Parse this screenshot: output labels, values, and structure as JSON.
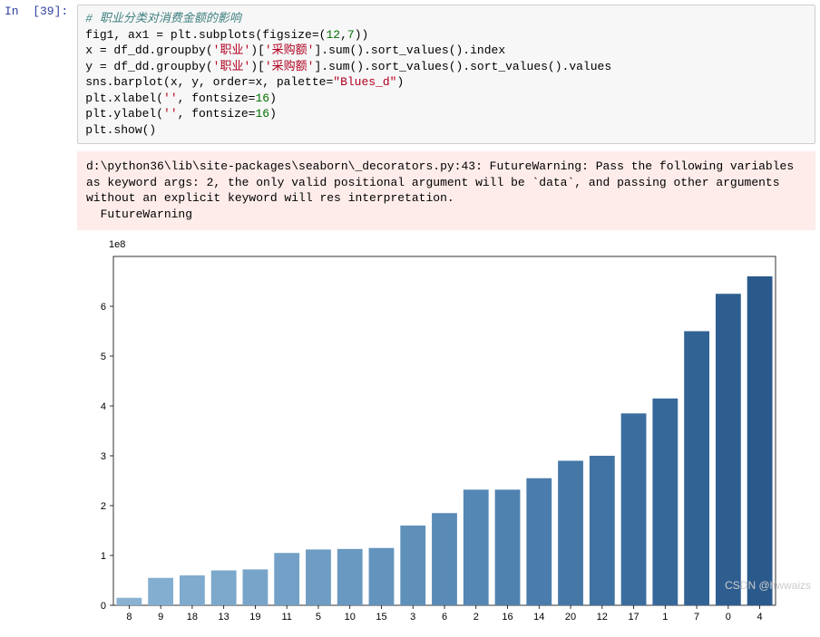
{
  "prompt": "In  [39]:",
  "code": {
    "comment": "# 职业分类对消费金额的影响",
    "line1_a": "fig1, ax1 = plt.subplots(figsize=(",
    "line1_b": "12",
    "line1_c": ",",
    "line1_d": "7",
    "line1_e": "))",
    "line2_a": "x = df_dd.groupby(",
    "line2_b": "'职业'",
    "line2_c": ")[",
    "line2_d": "'采购额'",
    "line2_e": "].sum().sort_values().index",
    "line3_a": "y = df_dd.groupby(",
    "line3_b": "'职业'",
    "line3_c": ")[",
    "line3_d": "'采购额'",
    "line3_e": "].sum().sort_values().sort_values().values",
    "line4_a": "sns.barplot(x, y, order=x, palette=",
    "line4_b": "\"Blues_d\"",
    "line4_c": ")",
    "line5_a": "plt.xlabel(",
    "line5_b": "''",
    "line5_c": ", fontsize=",
    "line5_d": "16",
    "line5_e": ")",
    "line6_a": "plt.ylabel(",
    "line6_b": "''",
    "line6_c": ", fontsize=",
    "line6_d": "16",
    "line6_e": ")",
    "line7": "plt.show()"
  },
  "warning": "d:\\python36\\lib\\site-packages\\seaborn\\_decorators.py:43: FutureWarning: Pass the following variables as keyword args: 2, the only valid positional argument will be `data`, and passing other arguments without an explicit keyword will res interpretation.\n  FutureWarning",
  "scale_label": "1e8",
  "chart_data": {
    "type": "bar",
    "categories": [
      "8",
      "9",
      "18",
      "13",
      "19",
      "11",
      "5",
      "10",
      "15",
      "3",
      "6",
      "2",
      "16",
      "14",
      "20",
      "12",
      "17",
      "1",
      "7",
      "0",
      "4"
    ],
    "values": [
      0.15,
      0.55,
      0.6,
      0.7,
      0.72,
      1.05,
      1.12,
      1.13,
      1.15,
      1.6,
      1.85,
      2.32,
      2.32,
      2.55,
      2.9,
      3.0,
      3.85,
      4.15,
      5.5,
      6.25,
      6.6
    ],
    "title": "",
    "xlabel": "",
    "ylabel": "",
    "ylim": [
      0,
      7
    ],
    "yticks": [
      0,
      1,
      2,
      3,
      4,
      5,
      6
    ],
    "scale": "1e8",
    "palette": "Blues_d",
    "colors": [
      "#88b1d2",
      "#84aed0",
      "#80abce",
      "#7ca8cb",
      "#78a4c9",
      "#73a0c6",
      "#6e9cc3",
      "#6998c0",
      "#6494bd",
      "#5f90ba",
      "#598bb6",
      "#5487b3",
      "#4f82af",
      "#4a7dab",
      "#4578a7",
      "#4073a2",
      "#3b6e9e",
      "#37689a",
      "#326395",
      "#2e5e90",
      "#2a598b"
    ]
  },
  "watermark": "CSDN @hwwaizs"
}
